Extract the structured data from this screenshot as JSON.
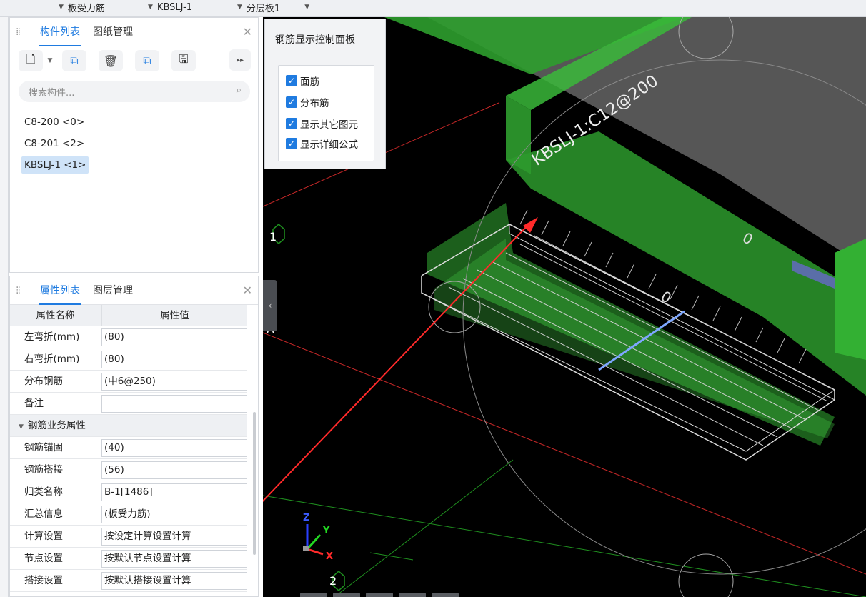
{
  "toolbar": {
    "dropdowns": [
      {
        "label": "板受力筋"
      },
      {
        "label": "KBSLJ-1"
      },
      {
        "label": "分层板1"
      }
    ]
  },
  "component_panel": {
    "tabs": [
      "构件列表",
      "图纸管理"
    ],
    "active_tab": 0,
    "search_placeholder": "搜索构件...",
    "items": [
      {
        "label": "C8-200 <0>",
        "selected": false
      },
      {
        "label": "C8-201 <2>",
        "selected": false
      },
      {
        "label": "KBSLJ-1 <1>",
        "selected": true
      }
    ]
  },
  "property_panel": {
    "tabs": [
      "属性列表",
      "图层管理"
    ],
    "active_tab": 0,
    "header": {
      "name": "属性名称",
      "value": "属性值"
    },
    "rows_top": [
      {
        "name": "左弯折(mm)",
        "value": "(80)"
      },
      {
        "name": "右弯折(mm)",
        "value": "(80)"
      },
      {
        "name": "分布钢筋",
        "value": "(中6@250)"
      },
      {
        "name": "备注",
        "value": ""
      }
    ],
    "group": "钢筋业务属性",
    "rows_group": [
      {
        "name": "钢筋锚固",
        "value": "(40)"
      },
      {
        "name": "钢筋搭接",
        "value": "(56)"
      },
      {
        "name": "归类名称",
        "value": "B-1[1486]"
      },
      {
        "name": "汇总信息",
        "value": "(板受力筋)"
      },
      {
        "name": "计算设置",
        "value": "按设定计算设置计算"
      },
      {
        "name": "节点设置",
        "value": "按默认节点设置计算"
      },
      {
        "name": "搭接设置",
        "value": "按默认搭接设置计算"
      }
    ]
  },
  "rebar_control": {
    "title": "钢筋显示控制面板",
    "options": [
      {
        "label": "面筋",
        "checked": true
      },
      {
        "label": "分布筋",
        "checked": true
      },
      {
        "label": "显示其它图元",
        "checked": true
      },
      {
        "label": "显示详细公式",
        "checked": true
      }
    ]
  },
  "viewport": {
    "rebar_label": "KBSLJ-1:C12@200",
    "zero_labels": [
      "0",
      "0"
    ],
    "axis_labels": [
      "1",
      "A",
      "2"
    ],
    "gizmo_labels": [
      "Z",
      "Y",
      "X"
    ]
  }
}
